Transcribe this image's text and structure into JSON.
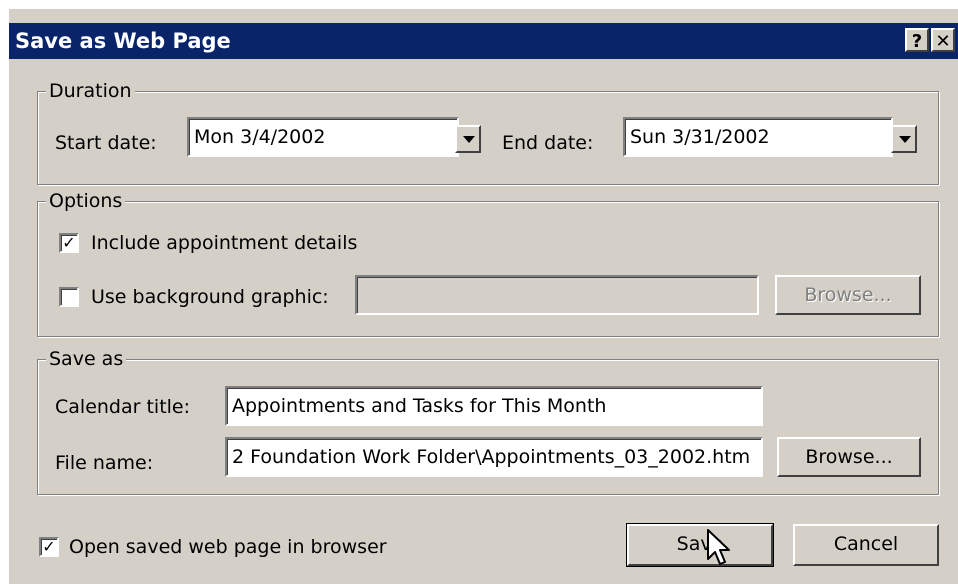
{
  "window": {
    "title": "Save as Web Page",
    "help_label": "?",
    "close_label": "✕"
  },
  "duration": {
    "legend": "Duration",
    "start_label": "Start date:",
    "start_value": "Mon 3/4/2002",
    "end_label": "End date:",
    "end_value": "Sun 3/31/2002"
  },
  "options": {
    "legend": "Options",
    "include_details_label": "Include appointment details",
    "include_details_checked": true,
    "bg_graphic_label": "Use background graphic:",
    "bg_graphic_checked": false,
    "bg_graphic_value": "",
    "browse_label": "Browse..."
  },
  "save_as": {
    "legend": "Save as",
    "calendar_title_label": "Calendar title:",
    "calendar_title_value": "Appointments and Tasks for This Month",
    "file_name_label": "File name:",
    "file_name_value": "2 Foundation Work Folder\\Appointments_03_2002.htm",
    "browse_label": "Browse..."
  },
  "footer": {
    "open_in_browser_label": "Open saved web page in browser",
    "open_in_browser_checked": true,
    "save_label": "Save",
    "cancel_label": "Cancel"
  },
  "icons": {
    "check_glyph": "✓",
    "dropdown": "chevron-down-icon",
    "cursor": "mouse-pointer-icon"
  }
}
